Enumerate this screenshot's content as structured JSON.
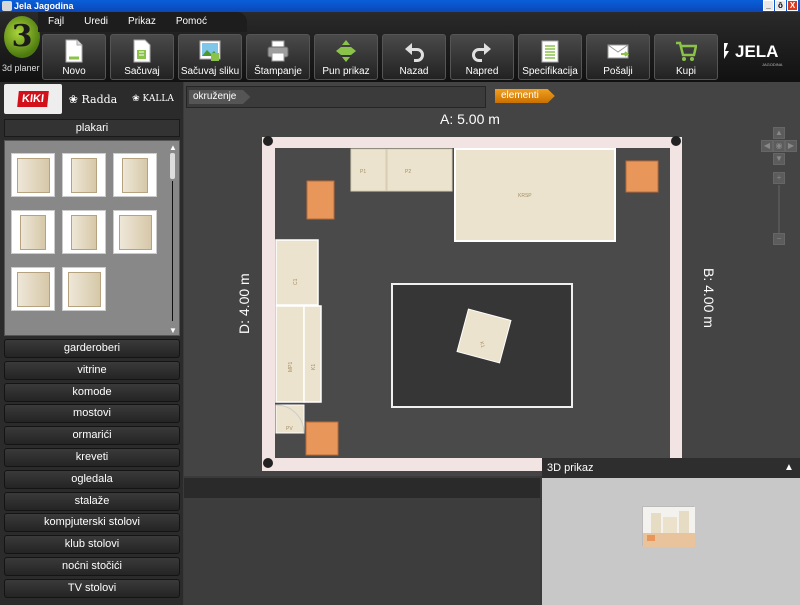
{
  "window": {
    "title": "Jela Jagodina",
    "buttons": [
      "_",
      "ô",
      "X"
    ]
  },
  "app": {
    "logo_label": "3d planer"
  },
  "menu": {
    "items": [
      "Fajl",
      "Uredi",
      "Prikaz",
      "Pomoć"
    ]
  },
  "toolbar": {
    "buttons": [
      {
        "label": "Novo",
        "icon": "new-document-icon"
      },
      {
        "label": "Sačuvaj",
        "icon": "save-document-icon"
      },
      {
        "label": "Sačuvaj sliku",
        "icon": "save-image-icon"
      },
      {
        "label": "Štampanje",
        "icon": "printer-icon"
      },
      {
        "label": "Pun prikaz",
        "icon": "fit-view-icon"
      },
      {
        "label": "Nazad",
        "icon": "undo-arrow-icon"
      },
      {
        "label": "Napred",
        "icon": "redo-arrow-icon"
      },
      {
        "label": "Specifikacija",
        "icon": "specification-list-icon"
      },
      {
        "label": "Pošalji",
        "icon": "send-envelope-icon"
      },
      {
        "label": "Kupi",
        "icon": "shopping-cart-icon"
      }
    ]
  },
  "brand_logo": {
    "name": "JELA",
    "sub": "JAGODINA"
  },
  "brands": {
    "items": [
      "KIKI",
      "Radda",
      "KALLA"
    ],
    "active": "KIKI"
  },
  "catalog": {
    "selected_category": "plakari",
    "thumbnail_count": 8,
    "categories": [
      "garderoberi",
      "vitrine",
      "komode",
      "mostovi",
      "ormarići",
      "kreveti",
      "ogledala",
      "stalaže",
      "kompjuterski stolovi",
      "klub stolovi",
      "noćni stočići",
      "TV stolovi"
    ]
  },
  "breadcrumbs": {
    "left": "okruženje",
    "right": "elementi"
  },
  "room": {
    "dim_a": "A:  5.00  m",
    "dim_b": "B:  4.00  m",
    "dim_d": "D:  4.00  m",
    "labels": {
      "p1": "P1",
      "p2": "P2",
      "krsp": "KRSP",
      "c1": "C1",
      "mp": "MP1",
      "k": "K1",
      "sv": "SV",
      "pv": "PV"
    }
  },
  "view3d": {
    "title": "3D  prikaz",
    "collapse": "▲"
  },
  "colors": {
    "accent_orange": "#f0a020",
    "brand_red": "#d3101a",
    "logo_green": "#7fb526"
  }
}
